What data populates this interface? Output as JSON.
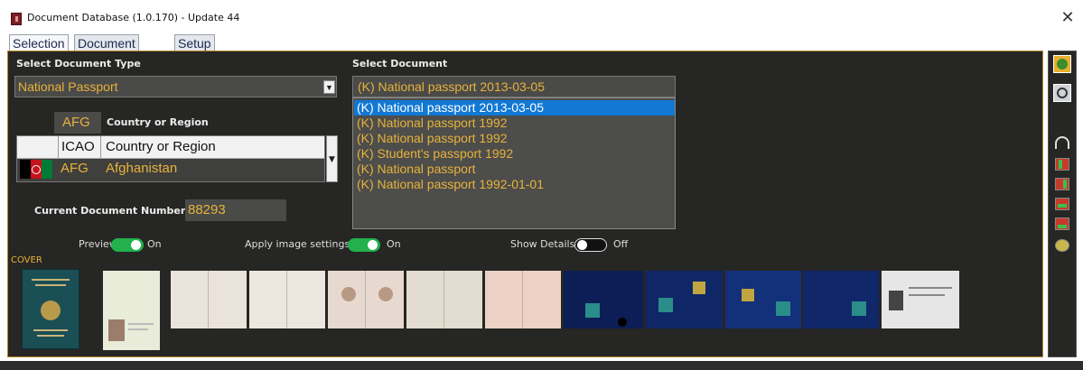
{
  "window": {
    "title": "Document Database (1.0.170) - Update 44",
    "close": "✕"
  },
  "tabs": [
    {
      "label": "Selection",
      "active": true
    },
    {
      "label": "Document Data",
      "active": false
    },
    {
      "label": "Setup",
      "active": false
    }
  ],
  "doc_type": {
    "label": "Select Document Type",
    "value": "National Passport"
  },
  "country": {
    "code": "AFG",
    "label": "Country or Region",
    "header": {
      "code": "ICAO",
      "name": "Country or Region"
    },
    "row": {
      "code": "AFG",
      "name": "Afghanistan"
    }
  },
  "current_doc": {
    "label": "Current Document Number",
    "value": "88293"
  },
  "select_document": {
    "label": "Select Document",
    "value": "(K) National passport 2013-03-05",
    "items": [
      "(K) National passport 2013-03-05",
      "(K) National passport 1992",
      "(K) National passport 1992",
      "(K) Student's passport 1992",
      "(K) National passport",
      "(K) National passport 1992-01-01"
    ],
    "selected_index": 0
  },
  "toggles": {
    "preview": {
      "label": "Preview",
      "state": "On",
      "on": true
    },
    "image_settings": {
      "label": "Apply image settings",
      "state": "On",
      "on": true
    },
    "details": {
      "label": "Show Details",
      "state": "Off",
      "on": false
    }
  },
  "gallery": {
    "cover_label": "COVER"
  },
  "colors": {
    "accent": "#e7b33a",
    "panel": "#262624",
    "selection": "#1178d4",
    "toggle_on": "#22b14c"
  }
}
